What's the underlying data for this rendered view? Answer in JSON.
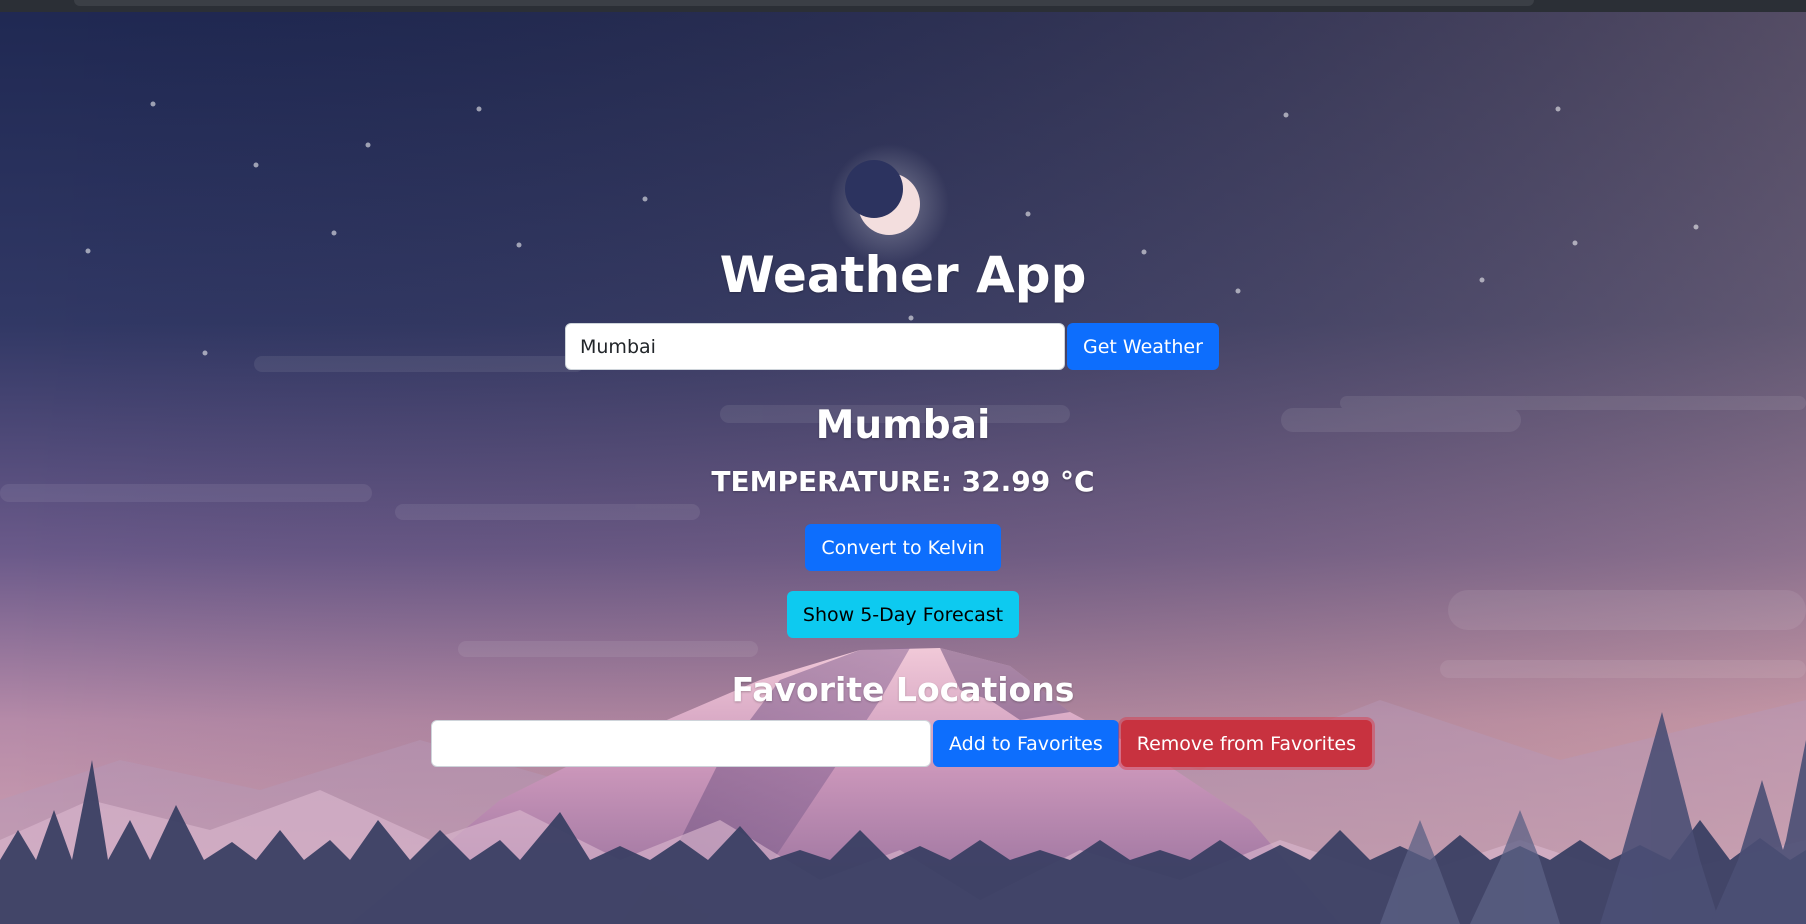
{
  "app": {
    "title": "Weather App"
  },
  "search": {
    "value": "Mumbai",
    "placeholder": "",
    "button_label": "Get Weather"
  },
  "weather": {
    "city": "Mumbai",
    "temperature_text": "TEMPERATURE: 32.99 °C"
  },
  "actions": {
    "convert_label": "Convert to Kelvin",
    "forecast_label": "Show 5-Day Forecast"
  },
  "favorites": {
    "title": "Favorite Locations",
    "input_value": "",
    "add_label": "Add to Favorites",
    "remove_label": "Remove from Favorites"
  },
  "colors": {
    "primary": "#0d6efd",
    "info": "#0dcaf0",
    "danger": "#c8323f",
    "sky_top": "#1f2852",
    "sky_bottom": "#c98fa8"
  },
  "icons": {
    "moon": "moon-icon"
  }
}
